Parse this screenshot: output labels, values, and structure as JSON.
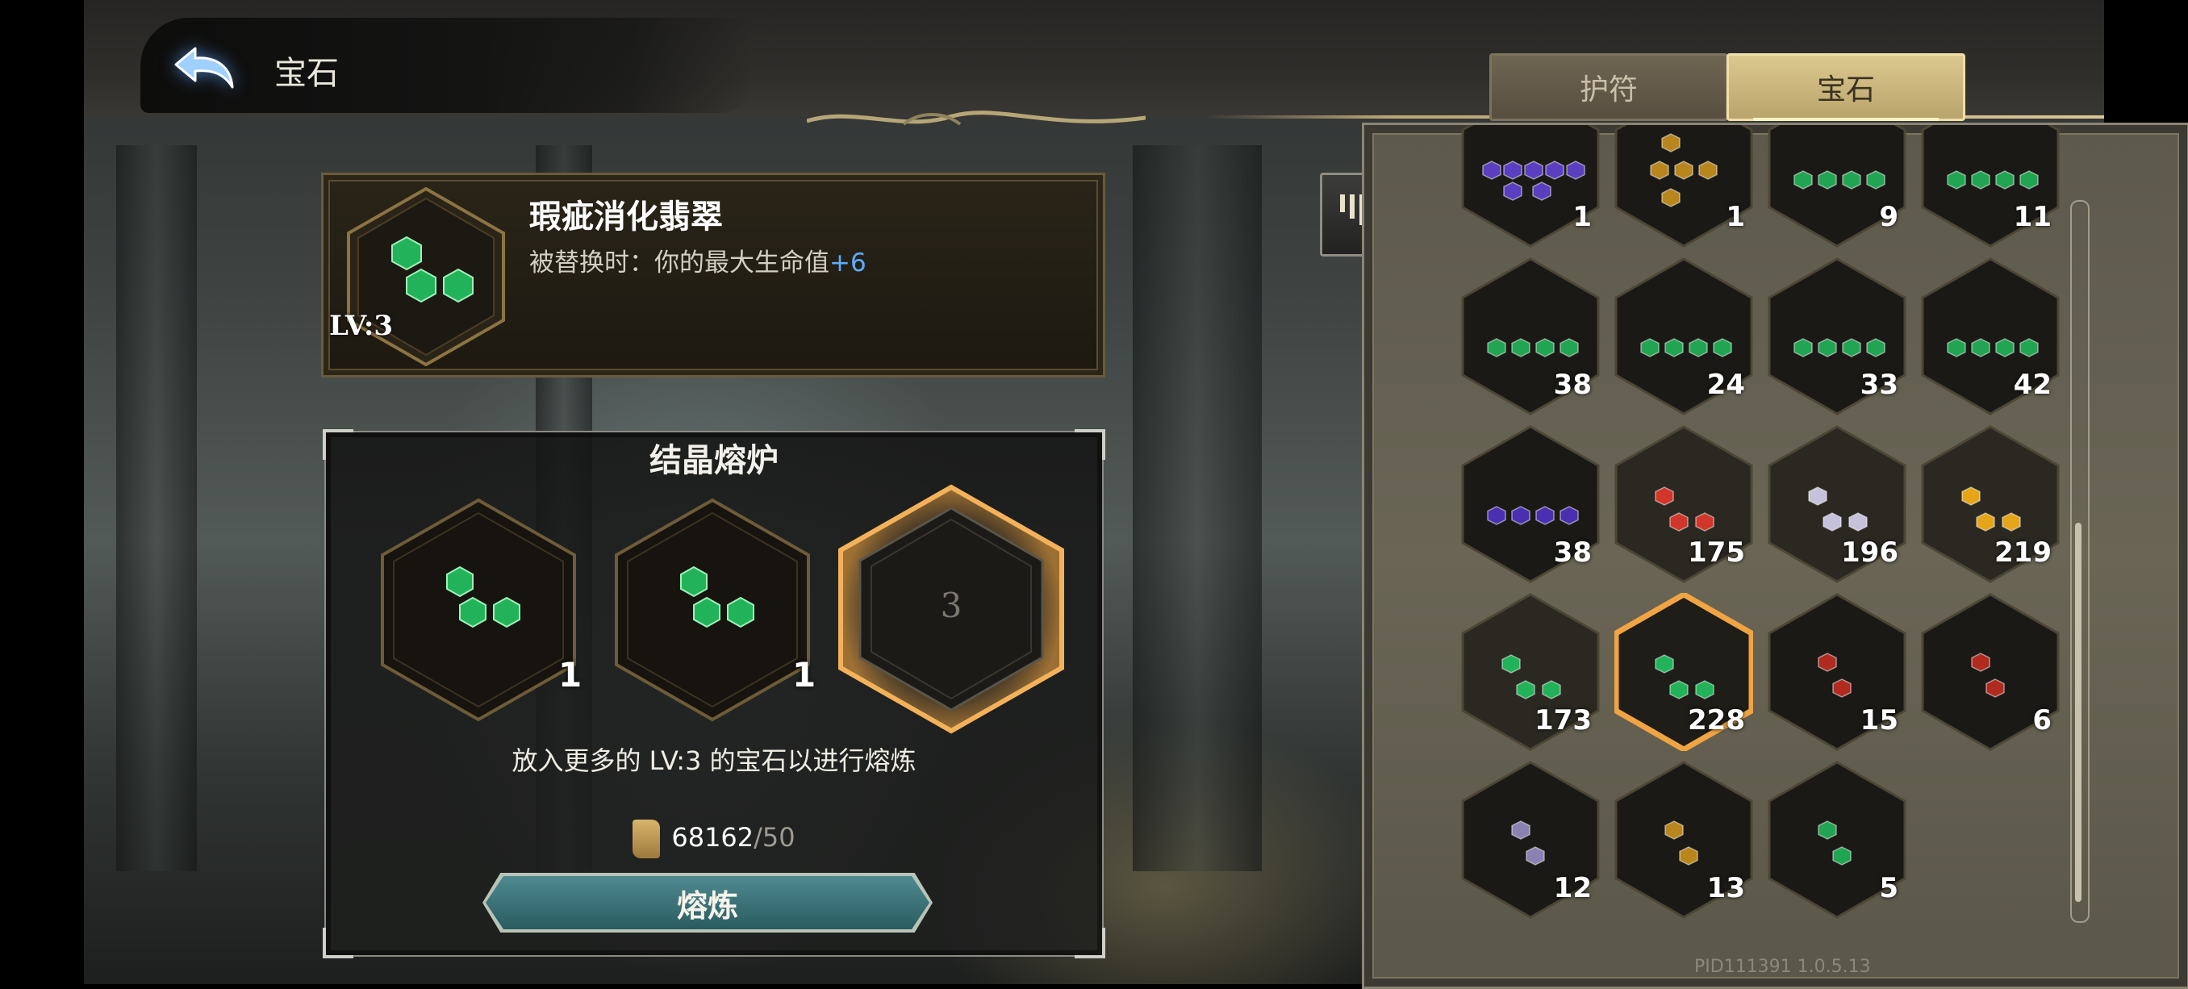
{
  "header": {
    "title": "宝石",
    "back_icon": "back-arrow-icon"
  },
  "tabs": [
    {
      "label": "护符",
      "selected": false
    },
    {
      "label": "宝石",
      "selected": true
    }
  ],
  "selected_gem": {
    "name": "瑕疵消化翡翠",
    "level": "LV:3",
    "effect_prefix": "被替换时：你的最大生命值",
    "effect_value": "+6",
    "color": "#22b35a"
  },
  "furnace": {
    "title": "结晶熔炉",
    "slots": [
      {
        "count": "1",
        "gem_color": "#22b35a",
        "filled": true
      },
      {
        "count": "1",
        "gem_color": "#22b35a",
        "filled": true
      },
      {
        "placeholder": "3",
        "filled": false,
        "highlighted": true
      }
    ],
    "hint": "放入更多的 LV:3 的宝石以进行熔炼",
    "cost_have": "68162",
    "cost_need": "/50",
    "cost_icon": "scroll-icon",
    "smelt_label": "熔炼"
  },
  "sort_icon": "sort-icon",
  "inventory": [
    {
      "count": "1",
      "color": "#5a3fc0",
      "gems": 7,
      "bg": "#1a1915"
    },
    {
      "count": "1",
      "color": "#b8861c",
      "gems": 5,
      "bg": "#1a1915"
    },
    {
      "count": "9",
      "color": "#22a552",
      "gems": 4,
      "bg": "#1a1915"
    },
    {
      "count": "11",
      "color": "#22a552",
      "gems": 4,
      "bg": "#1a1915"
    },
    {
      "count": "38",
      "color": "#22a552",
      "gems": 4,
      "bg": "#1a1915"
    },
    {
      "count": "24",
      "color": "#22a552",
      "gems": 4,
      "bg": "#1a1915"
    },
    {
      "count": "33",
      "color": "#22a552",
      "gems": 4,
      "bg": "#1a1915"
    },
    {
      "count": "42",
      "color": "#22a552",
      "gems": 4,
      "bg": "#1a1915"
    },
    {
      "count": "38",
      "color": "#4a2fb0",
      "gems": 4,
      "bg": "#1a1915"
    },
    {
      "count": "175",
      "color": "#d0362a",
      "gems": 3,
      "bg": "#2a2820"
    },
    {
      "count": "196",
      "color": "#c6c2dc",
      "gems": 3,
      "bg": "#2a2820"
    },
    {
      "count": "219",
      "color": "#e6a418",
      "gems": 3,
      "bg": "#2a2820"
    },
    {
      "count": "173",
      "color": "#22b35a",
      "gems": 3,
      "bg": "#2a2820"
    },
    {
      "count": "228",
      "color": "#22b35a",
      "gems": 3,
      "bg": "#1f1d18",
      "highlighted": true
    },
    {
      "count": "15",
      "color": "#b02a20",
      "gems": 2,
      "bg": "#1a1915"
    },
    {
      "count": "6",
      "color": "#b02a20",
      "gems": 2,
      "bg": "#1a1915"
    },
    {
      "count": "12",
      "color": "#8a82b0",
      "gems": 2,
      "bg": "#1a1915"
    },
    {
      "count": "13",
      "color": "#b8861c",
      "gems": 2,
      "bg": "#1a1915"
    },
    {
      "count": "5",
      "color": "#22a552",
      "gems": 2,
      "bg": "#1a1915"
    }
  ],
  "version": "PID111391  1.0.5.13",
  "colors": {
    "accent_gold": "#d9c693",
    "highlight_orange": "#f0a442",
    "plus_blue": "#5aaeff"
  }
}
